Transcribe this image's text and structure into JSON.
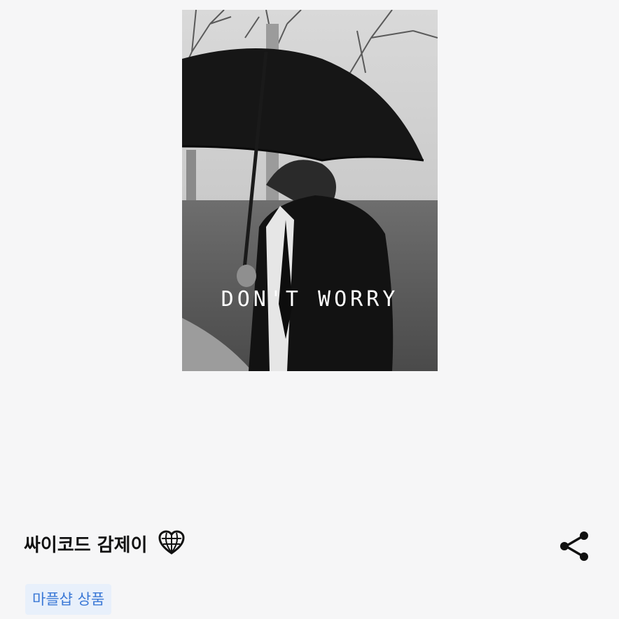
{
  "product": {
    "image_caption": "DON'T WORRY",
    "title": "싸이코드 감제이",
    "badge": "마플샵 상품"
  },
  "icons": {
    "title_icon": "heart-globe-icon",
    "share": "share-icon"
  },
  "colors": {
    "background": "#f6f6f7",
    "badge_bg": "#e8f0fb",
    "badge_text": "#3a78d6",
    "title_text": "#111111"
  }
}
